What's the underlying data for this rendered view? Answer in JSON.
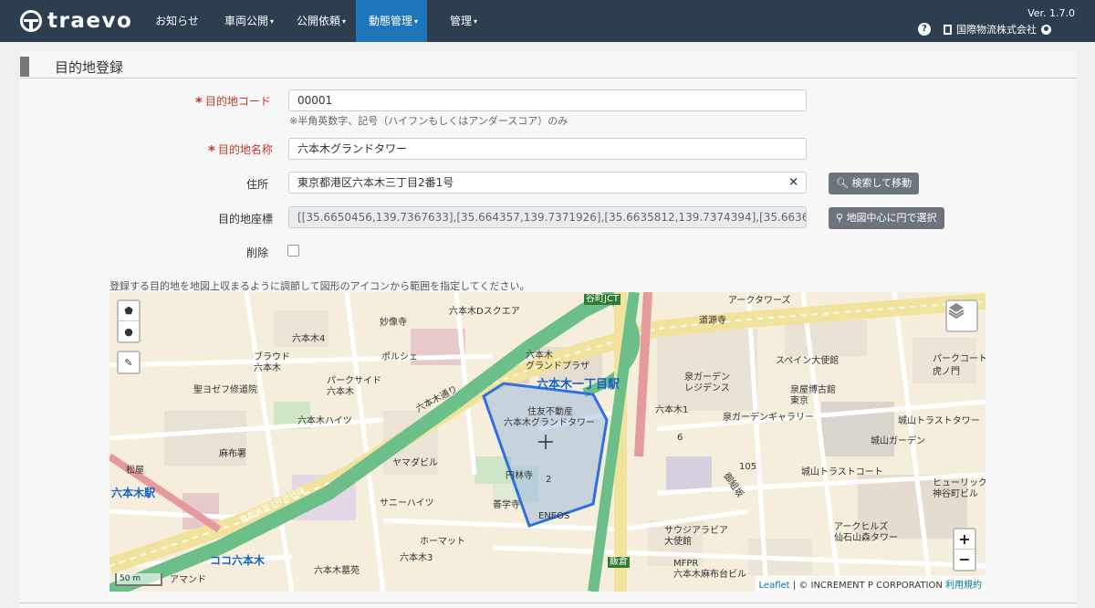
{
  "app": {
    "logo_text": "traevo",
    "version": "Ver. 1.7.0",
    "company": "国際物流株式会社"
  },
  "nav": {
    "items": [
      {
        "label": "お知らせ",
        "caret": ""
      },
      {
        "label": "車両公開",
        "caret": "▾"
      },
      {
        "label": "公開依頼",
        "caret": "▾"
      },
      {
        "label": "動態管理",
        "caret": "▾"
      },
      {
        "label": "管理",
        "caret": "▾"
      }
    ]
  },
  "page": {
    "title": "目的地登録"
  },
  "form": {
    "code": {
      "label": "目的地コード",
      "value": "00001",
      "hint": "※半角英数字、記号（ハイフンもしくはアンダースコア）のみ"
    },
    "name": {
      "label": "目的地名称",
      "value": "六本木グランドタワー"
    },
    "address": {
      "label": "住所",
      "value": "東京都港区六本木三丁目2番1号",
      "clear": "×"
    },
    "coords": {
      "label": "目的地座標",
      "value": "[[35.6650456,139.7367633],[35.664357,139.7371926],[35.6635812,139.7374394],[35.6636945,139.73"
    },
    "delete": {
      "label": "削除",
      "checked": false
    },
    "required_mark": "*"
  },
  "buttons": {
    "search_move": "検索して移動",
    "circle_select": "地図中心に円で選択"
  },
  "map": {
    "hint": "登録する目的地を地図上収まるように調節して図形のアイコンから範囲を指定してください。",
    "scale_label": "50 m",
    "zoom_in": "+",
    "zoom_out": "−",
    "attribution": {
      "leaflet": "Leaflet",
      "sep": " | © INCREMENT P CORPORATION ",
      "terms": "利用規約"
    },
    "labels": {
      "l1": "谷町JCT",
      "l2": "アークタワーズ",
      "l3": "妙像寺",
      "l4": "六本木Dスクエア",
      "l5": "道源寺",
      "l6": "六本木4",
      "l7": "ブラウド",
      "l8": "六本木",
      "l9": "ポルシェ",
      "l10": "六本木",
      "l11": "グランドプラザ",
      "l12": "スペイン大使館",
      "l13": "パークコート",
      "l14": "虎ノ門",
      "l15": "パークサイド",
      "l16": "六本木",
      "l17": "聖ヨゼフ修道院",
      "l18": "六本木一丁目駅",
      "l19": "泉ガーデン",
      "l20": "レジデンス",
      "l21": "泉屋博古館",
      "l22": "東京",
      "l23": "住友不動産",
      "l24": "六本木グランドタワー",
      "l25": "六本木ハイツ",
      "l26": "六本木通り",
      "l27": "六本木1",
      "l28": "泉ガーデンギャラリー",
      "l29": "城山トラストタワー",
      "l30": "麻布署",
      "l31": "城山ガーデン",
      "l32": "松屋",
      "l33": "ヤマダビル",
      "l34": "円林寺",
      "l35": "城山トラストコート",
      "l36": "六本木駅",
      "l37": "サニーハイツ",
      "l38": "善学寺",
      "l39": "ヒューリック",
      "l40": "神谷町ビル",
      "l41": "首都高速3号渋谷線",
      "l42": "ENEOS",
      "l43": "サウジアラビア",
      "l44": "大使館",
      "l45": "アークヒルズ",
      "l46": "仙石山森タワー",
      "l47": "ホーマット",
      "l48": "ココ六本木",
      "l49": "六本木3",
      "l50": "MFPR",
      "l51": "六本木麻布台ビル",
      "l52": "六本木墓苑",
      "l53": "アマンド",
      "l54": "飯倉",
      "l55": "御組坂",
      "l56": "105",
      "l57": "6",
      "l58": "2"
    }
  }
}
